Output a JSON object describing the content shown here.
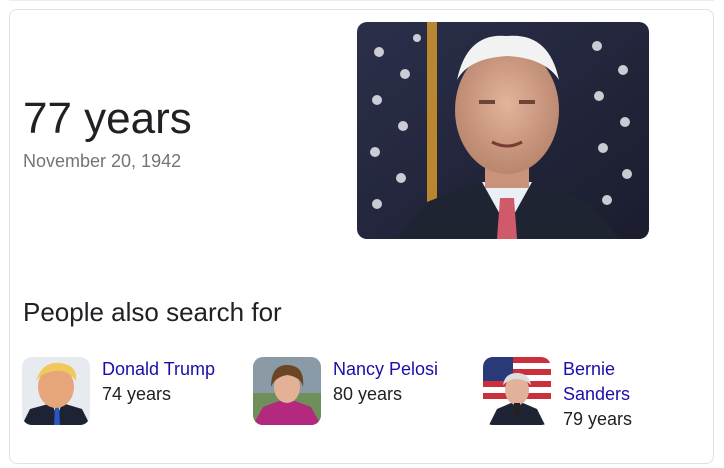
{
  "knowledge_panel": {
    "age_value": "77 years",
    "birth_date": "November 20, 1942"
  },
  "people_also_search": {
    "heading": "People also search for",
    "people": [
      {
        "name": "Donald Trump",
        "age": "74 years"
      },
      {
        "name": "Nancy Pelosi",
        "age": "80 years"
      },
      {
        "name": "Bernie Sanders",
        "age": "79 years"
      }
    ]
  },
  "colors": {
    "link": "#1a0dab",
    "primary_text": "#202124",
    "secondary_text": "#70757a",
    "card_border": "#dfe1e5"
  }
}
